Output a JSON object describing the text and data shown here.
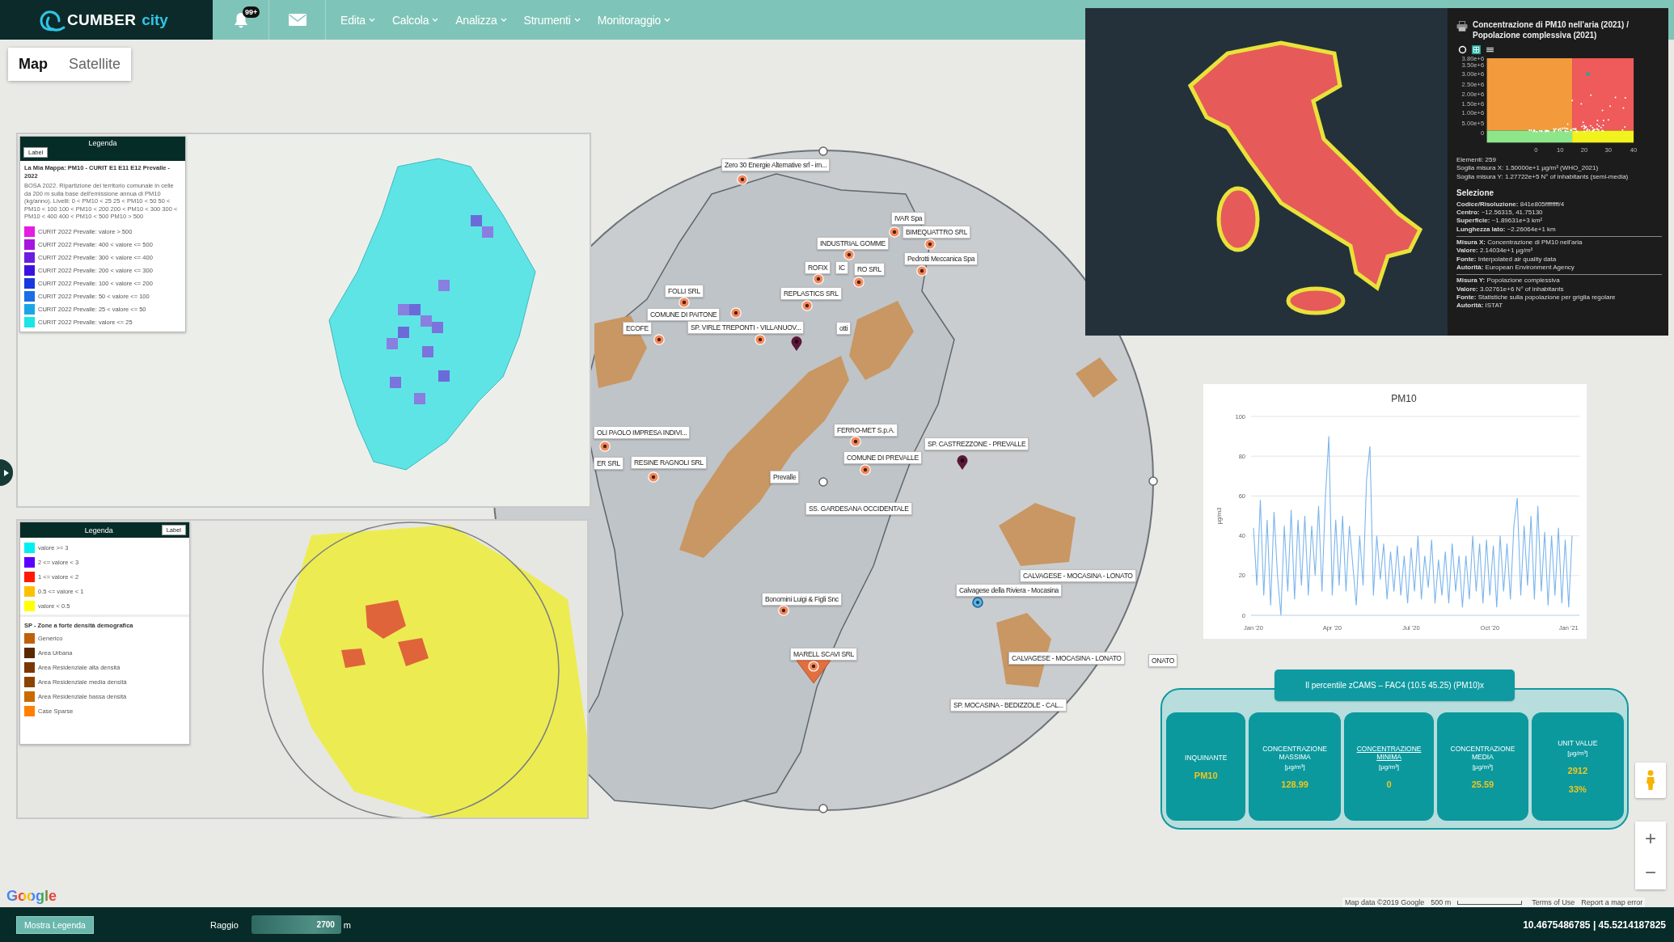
{
  "nav": {
    "logo": {
      "name": "CUMBER",
      "suffix": "city"
    },
    "notifications": {
      "badge": "99+"
    },
    "menus": [
      {
        "label": "Edita"
      },
      {
        "label": "Calcola"
      },
      {
        "label": "Analizza"
      },
      {
        "label": "Strumenti"
      },
      {
        "label": "Monitoraggio"
      }
    ]
  },
  "map_type_tabs": [
    {
      "label": "Map",
      "selected": true
    },
    {
      "label": "Satellite",
      "selected": false
    }
  ],
  "emissions_inset": {
    "legend": {
      "title": "Legenda",
      "button": "Label",
      "map_title": "La Mia Mappa: PM10 - CURIT E1 E11 E12 Prevalle - 2022",
      "description": "BOSA 2022. Ripartizione del territorio comunale in celle da 200 m sulla base dell'emissione annua di PM10 (kg/anno). Livelli: 0 < PM10 < 25 25 < PM10 < 50 50 < PM10 < 100 100 < PM10 < 200 200 < PM10 < 300 300 < PM10 < 400 400 < PM10 < 500 PM10 > 500",
      "items": [
        {
          "label": "CURIT 2022 Prevalle: valore > 500",
          "color": "#e51de0"
        },
        {
          "label": "CURIT 2022 Prevalle: 400 < valore <= 500",
          "color": "#a615e0"
        },
        {
          "label": "CURIT 2022 Prevalle: 300 < valore <= 400",
          "color": "#6a1ee0"
        },
        {
          "label": "CURIT 2022 Prevalle: 200 < valore <= 300",
          "color": "#3a12e0"
        },
        {
          "label": "CURIT 2022 Prevalle: 100 < valore <= 200",
          "color": "#1838e0"
        },
        {
          "label": "CURIT 2022 Prevalle: 50 < valore <= 100",
          "color": "#1a6ee6"
        },
        {
          "label": "CURIT 2022 Prevalle: 25 < valore <= 50",
          "color": "#1aa6e6"
        },
        {
          "label": "CURIT 2022 Prevalle: valore <= 25",
          "color": "#1ae6e6"
        }
      ]
    }
  },
  "zones_inset": {
    "legend": {
      "title": "Legenda",
      "button": "Label",
      "sections": [
        {
          "items": [
            {
              "label": "valore >= 3",
              "color": "#00f0f0"
            },
            {
              "label": "2 <= valore < 3",
              "color": "#5a00ff"
            },
            {
              "label": "1 <= valore < 2",
              "color": "#ff1a00"
            },
            {
              "label": "0.5 <= valore < 1",
              "color": "#ffc000"
            },
            {
              "label": "valore < 0.5",
              "color": "#ffff00"
            }
          ]
        },
        {
          "heading": "SP - Zone a forte densità demografica",
          "items": [
            {
              "label": "Generico",
              "color": "#c0600a"
            },
            {
              "label": "Area Urbana",
              "color": "#5a2800"
            },
            {
              "label": "Area Residenziale alta densità",
              "color": "#7a3800"
            },
            {
              "label": "Area Residenziale media densità",
              "color": "#8a4400"
            },
            {
              "label": "Area Residenziale bassa densità",
              "color": "#c86a00"
            },
            {
              "label": "Case Sparse",
              "color": "#ff8000"
            }
          ]
        }
      ]
    }
  },
  "markers": [
    {
      "label": "Zero 30 Energie Alternative srl - im...",
      "kind": "company"
    },
    {
      "label": "IVAR Spa",
      "kind": "company"
    },
    {
      "label": "BIMEQUATTRO SRL",
      "kind": "company"
    },
    {
      "label": "INDUSTRIAL GOMME",
      "kind": "company"
    },
    {
      "label": "Pedrotti Meccanica Spa",
      "kind": "company"
    },
    {
      "label": "ROFIX",
      "kind": "company"
    },
    {
      "label": "IC",
      "kind": "label"
    },
    {
      "label": "RO SRL",
      "kind": "company"
    },
    {
      "label": "REPLASTICS SRL",
      "kind": "company"
    },
    {
      "label": "FOLLI SRL",
      "kind": "company"
    },
    {
      "label": "COMUNE DI PAITONE",
      "kind": "company"
    },
    {
      "label": "ECOFE",
      "kind": "company"
    },
    {
      "label": "SP. VIRLE TREPONTI - VILLANUOV...",
      "kind": "company"
    },
    {
      "label": "otti",
      "kind": "site"
    },
    {
      "label": "OLI PAOLO IMPRESA INDIVI...",
      "kind": "company"
    },
    {
      "label": "ER SRL",
      "kind": "label"
    },
    {
      "label": "RESINE RAGNOLI SRL",
      "kind": "company"
    },
    {
      "label": "FERRO-MET S.p.A.",
      "kind": "company"
    },
    {
      "label": "COMUNE DI PREVALLE",
      "kind": "company"
    },
    {
      "label": "SP. CASTREZZONE - PREVALLE",
      "kind": "site"
    },
    {
      "label": "Prevalle",
      "kind": "place"
    },
    {
      "label": "SS. GARDESANA OCCIDENTALE",
      "kind": "label"
    },
    {
      "label": "CALVAGESE - MOCASINA - LONATO",
      "kind": "label"
    },
    {
      "label": "Calvagese della Riviera - Mocasina",
      "kind": "station"
    },
    {
      "label": "Bonomini Luigi & Figli Snc",
      "kind": "company"
    },
    {
      "label": "MARELL SCAVI SRL",
      "kind": "zone"
    },
    {
      "label": "CALVAGESE - MOCASINA - LONATO",
      "kind": "label"
    },
    {
      "label": "ONATO",
      "kind": "label"
    },
    {
      "label": "SP. MOCASINA - BEDIZZOLE - CAL...",
      "kind": "label"
    }
  ],
  "italy_inset": {
    "title": "Concentrazione di PM10 nell'aria (2021) / Popolazione complessiva (2021)",
    "view_modes": [
      {
        "kind": "ring",
        "selected": false
      },
      {
        "kind": "grid",
        "selected": true
      },
      {
        "kind": "list",
        "selected": false
      }
    ],
    "scatter": {
      "y_ticks": [
        "3.80e+6",
        "3.50e+6",
        "3.00e+6",
        "2.50e+6",
        "2.00e+6",
        "1.50e+6",
        "1.00e+6",
        "5.00e+5",
        "0"
      ],
      "x_ticks": [
        "0",
        "10",
        "20",
        "30",
        "40"
      ]
    },
    "stats": [
      "Elementi: 259",
      "Soglia misura X: 1.50000e+1 µg/m³ (WHO_2021)",
      "Soglia misura Y: 1.27722e+5 N° of inhabitants (semi-media)"
    ],
    "selection_title": "Selezione",
    "selection_groups": [
      {
        "lines": [
          "**Codice/Risoluzione:** 841e805ffffffff/4",
          "**Centro:** ~12.56315, 41.75130",
          "**Superficie:** ~1.89631e+3 km²",
          "**Lunghezza lato:** ~2.26064e+1 km"
        ]
      },
      {
        "lines": [
          "**Misura X:** Concentrazione di PM10 nell'aria",
          "**Valore:** 2.14034e+1 µg/m³",
          "**Fonte:** Interpolated air quality data",
          "**Autorità:** European Environment Agency"
        ]
      },
      {
        "lines": [
          "**Misura Y:** Popolazione complessiva",
          "**Valore:** 3.02761e+6 N° of inhabitants",
          "**Fonte:** Statistiche sulla popolazione per griglia regolare",
          "**Autorità:** ISTAT"
        ]
      }
    ]
  },
  "pm10_chart": {
    "chart_data": {
      "type": "line",
      "title": "PM10",
      "ylabel": "µg/m3",
      "categories": [
        "Jan '20",
        null,
        null,
        null,
        null,
        null,
        null,
        null,
        null,
        null,
        null,
        null,
        null,
        null,
        null,
        null,
        null,
        null,
        null,
        null,
        null,
        null,
        null,
        "Apr '20",
        null,
        null,
        null,
        null,
        null,
        null,
        null,
        null,
        null,
        null,
        null,
        null,
        null,
        null,
        null,
        null,
        null,
        null,
        null,
        null,
        null,
        null,
        "Jul '20",
        null,
        null,
        null,
        null,
        null,
        null,
        null,
        null,
        null,
        null,
        null,
        null,
        null,
        null,
        null,
        null,
        null,
        null,
        null,
        null,
        null,
        null,
        "Oct '20",
        null,
        null,
        null,
        null,
        null,
        null,
        null,
        null,
        null,
        null,
        null,
        null,
        null,
        null,
        null,
        null,
        null,
        null,
        null,
        null,
        null,
        null,
        "Jan '21",
        null
      ],
      "series": [
        {
          "color": "#7cb5ec",
          "values": [
            44,
            15,
            58,
            10,
            48,
            5,
            52,
            20,
            0,
            45,
            12,
            53,
            8,
            48,
            15,
            50,
            10,
            45,
            20,
            55,
            12,
            60,
            90,
            10,
            48,
            15,
            50,
            12,
            45,
            25,
            5,
            40,
            15,
            68,
            85,
            10,
            40,
            18,
            36,
            8,
            32,
            12,
            35,
            10,
            30,
            6,
            34,
            12,
            40,
            8,
            30,
            14,
            38,
            6,
            28,
            10,
            32,
            6,
            36,
            12,
            30,
            4,
            30,
            8,
            40,
            12,
            36,
            6,
            38,
            10,
            35,
            4,
            40,
            12,
            36,
            8,
            45,
            59,
            10,
            45,
            15,
            50,
            8,
            55,
            12,
            42,
            5,
            40,
            10,
            44,
            6,
            38,
            4,
            40
          ]
        }
      ],
      "ylim": [
        0,
        100
      ],
      "yticks": [
        0,
        20,
        40,
        60,
        80,
        100
      ],
      "grid": true
    }
  },
  "summary": {
    "title": "Il percentile zCAMS – FAC4 (10.5 45.25) (PM10)x",
    "cards": [
      {
        "heading": "INQUINANTE",
        "values": [
          "PM10"
        ],
        "hovered": false
      },
      {
        "heading": "CONCENTRAZIONE MASSIMA",
        "unit": "[µg/m³]",
        "values": [
          "128.99"
        ],
        "hovered": false
      },
      {
        "heading": "CONCENTRAZIONE MINIMA",
        "unit": "[µg/m³]",
        "values": [
          "0"
        ],
        "hovered": true
      },
      {
        "heading": "CONCENTRAZIONE MEDIA",
        "unit": "[µg/m³]",
        "values": [
          "25.59"
        ],
        "hovered": false
      },
      {
        "heading": "UNIT VALUE",
        "unit": "[µg/m³]",
        "values": [
          "2912",
          "33%"
        ],
        "hovered": false
      }
    ]
  },
  "map_controls": {
    "zoom": [
      "+",
      "−"
    ]
  },
  "map_footer": {
    "logo": "Google",
    "attribution": "Map data ©2019 Google",
    "scale": "500 m",
    "links": [
      "Terms of Use",
      "Report a map error"
    ]
  },
  "status_bar": {
    "legend_button": "Mostra Legenda",
    "radius_label": "Raggio",
    "radius_value": "2700",
    "radius_unit": "m",
    "coordinates": "10.4675486785 | 45.5214187825"
  }
}
